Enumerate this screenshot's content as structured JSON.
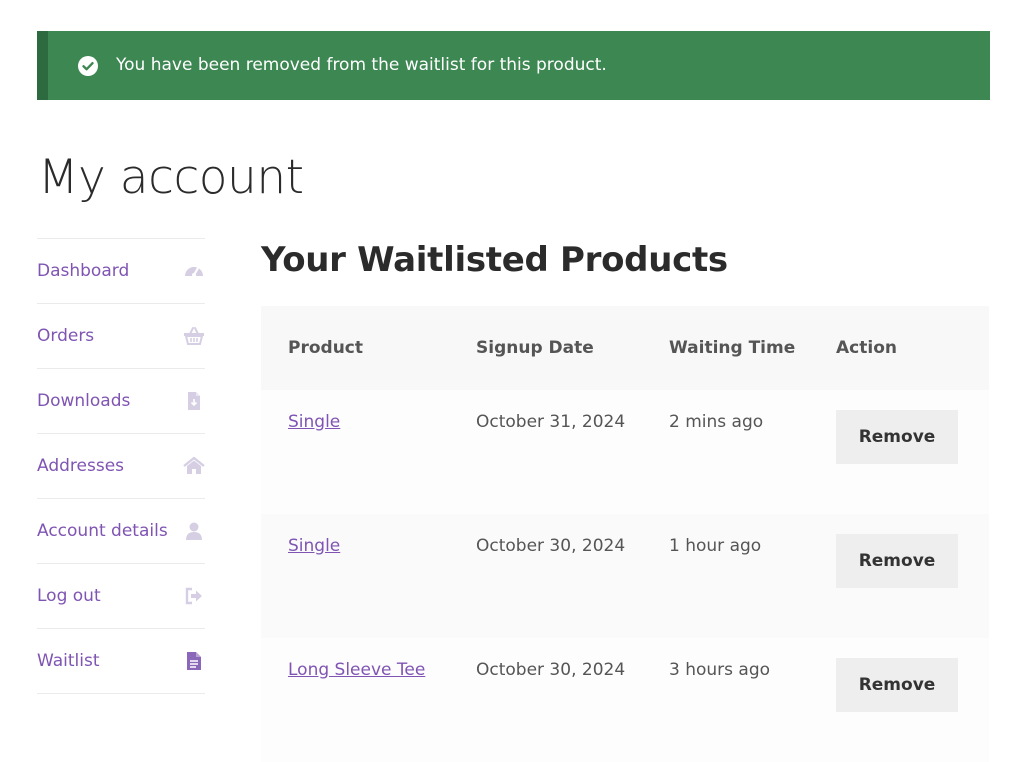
{
  "notice": {
    "message": "You have been removed from the waitlist for this product.",
    "bg_color": "#3d8752"
  },
  "page": {
    "title": "My account"
  },
  "nav": {
    "items": [
      {
        "label": "Dashboard",
        "icon": "dashboard-gauge-icon"
      },
      {
        "label": "Orders",
        "icon": "basket-icon"
      },
      {
        "label": "Downloads",
        "icon": "file-download-icon"
      },
      {
        "label": "Addresses",
        "icon": "home-icon"
      },
      {
        "label": "Account details",
        "icon": "user-icon"
      },
      {
        "label": "Log out",
        "icon": "logout-icon"
      },
      {
        "label": "Waitlist",
        "icon": "document-icon"
      }
    ],
    "link_color": "#7f54b3"
  },
  "waitlist": {
    "title": "Your Waitlisted Products",
    "headers": [
      "Product",
      "Signup Date",
      "Waiting Time",
      "Action"
    ],
    "rows": [
      {
        "product": "Single",
        "signup_date": "October 31, 2024",
        "waiting_time": "2 mins ago",
        "action": "Remove"
      },
      {
        "product": "Single",
        "signup_date": "October 30, 2024",
        "waiting_time": "1 hour ago",
        "action": "Remove"
      },
      {
        "product": "Long Sleeve Tee",
        "signup_date": "October 30, 2024",
        "waiting_time": "3 hours ago",
        "action": "Remove"
      }
    ]
  }
}
